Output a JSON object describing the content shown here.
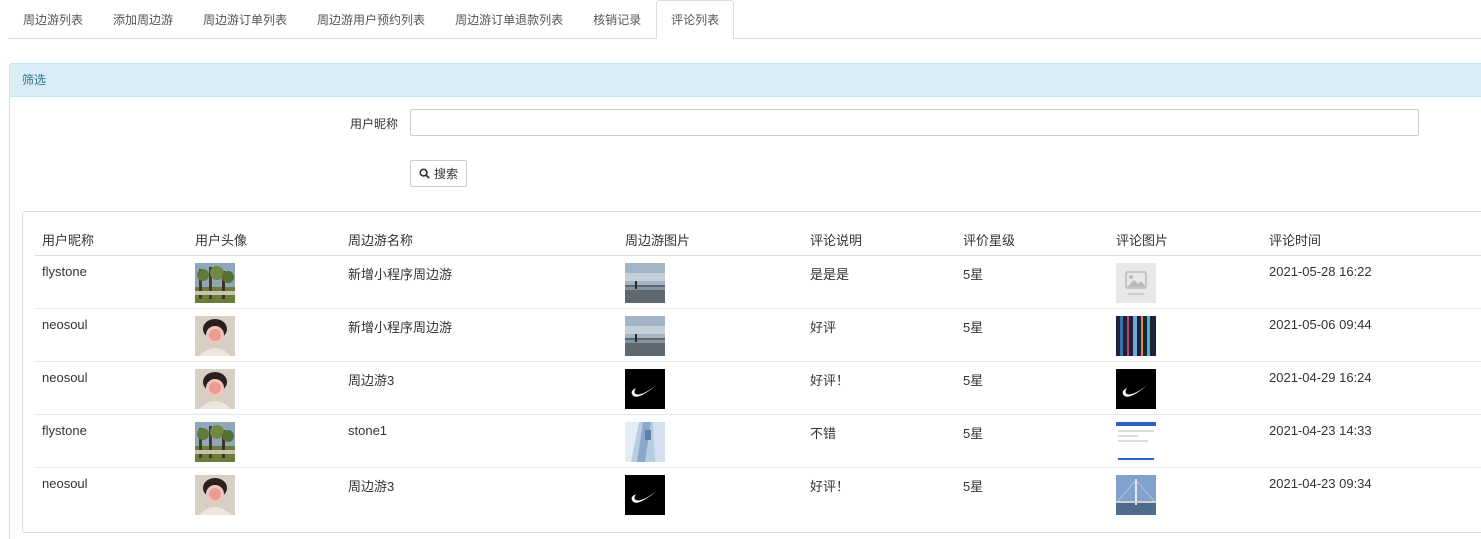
{
  "tabs": [
    {
      "label": "周边游列表",
      "active": false
    },
    {
      "label": "添加周边游",
      "active": false
    },
    {
      "label": "周边游订单列表",
      "active": false
    },
    {
      "label": "周边游用户预约列表",
      "active": false
    },
    {
      "label": "周边游订单退款列表",
      "active": false
    },
    {
      "label": "核销记录",
      "active": false
    },
    {
      "label": "评论列表",
      "active": true
    }
  ],
  "filter": {
    "heading": "筛选",
    "nickname_label": "用户昵称",
    "nickname_value": "",
    "search_label": "搜索"
  },
  "table": {
    "headers": [
      "用户昵称",
      "用户头像",
      "周边游名称",
      "周边游图片",
      "评论说明",
      "评价星级",
      "评论图片",
      "评论时间"
    ],
    "rows": [
      {
        "nickname": "flystone",
        "avatar": "avatar-trees",
        "tour_name": "新增小程序周边游",
        "tour_image": "pier-photo",
        "comment": "是是是",
        "rating": "5星",
        "comment_image": "placeholder-image",
        "time": "2021-05-28 16:22"
      },
      {
        "nickname": "neosoul",
        "avatar": "avatar-person",
        "tour_name": "新增小程序周边游",
        "tour_image": "pier-photo",
        "comment": "好评",
        "rating": "5星",
        "comment_image": "city-lights-photo",
        "time": "2021-05-06 09:44"
      },
      {
        "nickname": "neosoul",
        "avatar": "avatar-person",
        "tour_name": "周边游3",
        "tour_image": "nike-logo",
        "comment": "好评！",
        "rating": "5星",
        "comment_image": "nike-logo",
        "time": "2021-04-29 16:24"
      },
      {
        "nickname": "flystone",
        "avatar": "avatar-trees",
        "tour_name": "stone1",
        "tour_image": "abstract-blue-photo",
        "comment": "不错",
        "rating": "5星",
        "comment_image": "screenshot-thumbnail",
        "time": "2021-04-23 14:33"
      },
      {
        "nickname": "neosoul",
        "avatar": "avatar-person",
        "tour_name": "周边游3",
        "tour_image": "nike-logo",
        "comment": "好评！",
        "rating": "5星",
        "comment_image": "bridge-photo",
        "time": "2021-04-23 09:34"
      }
    ]
  },
  "colors": {
    "panel_heading_bg": "#d9edf7",
    "panel_heading_text": "#31708f",
    "border": "#ddd"
  }
}
